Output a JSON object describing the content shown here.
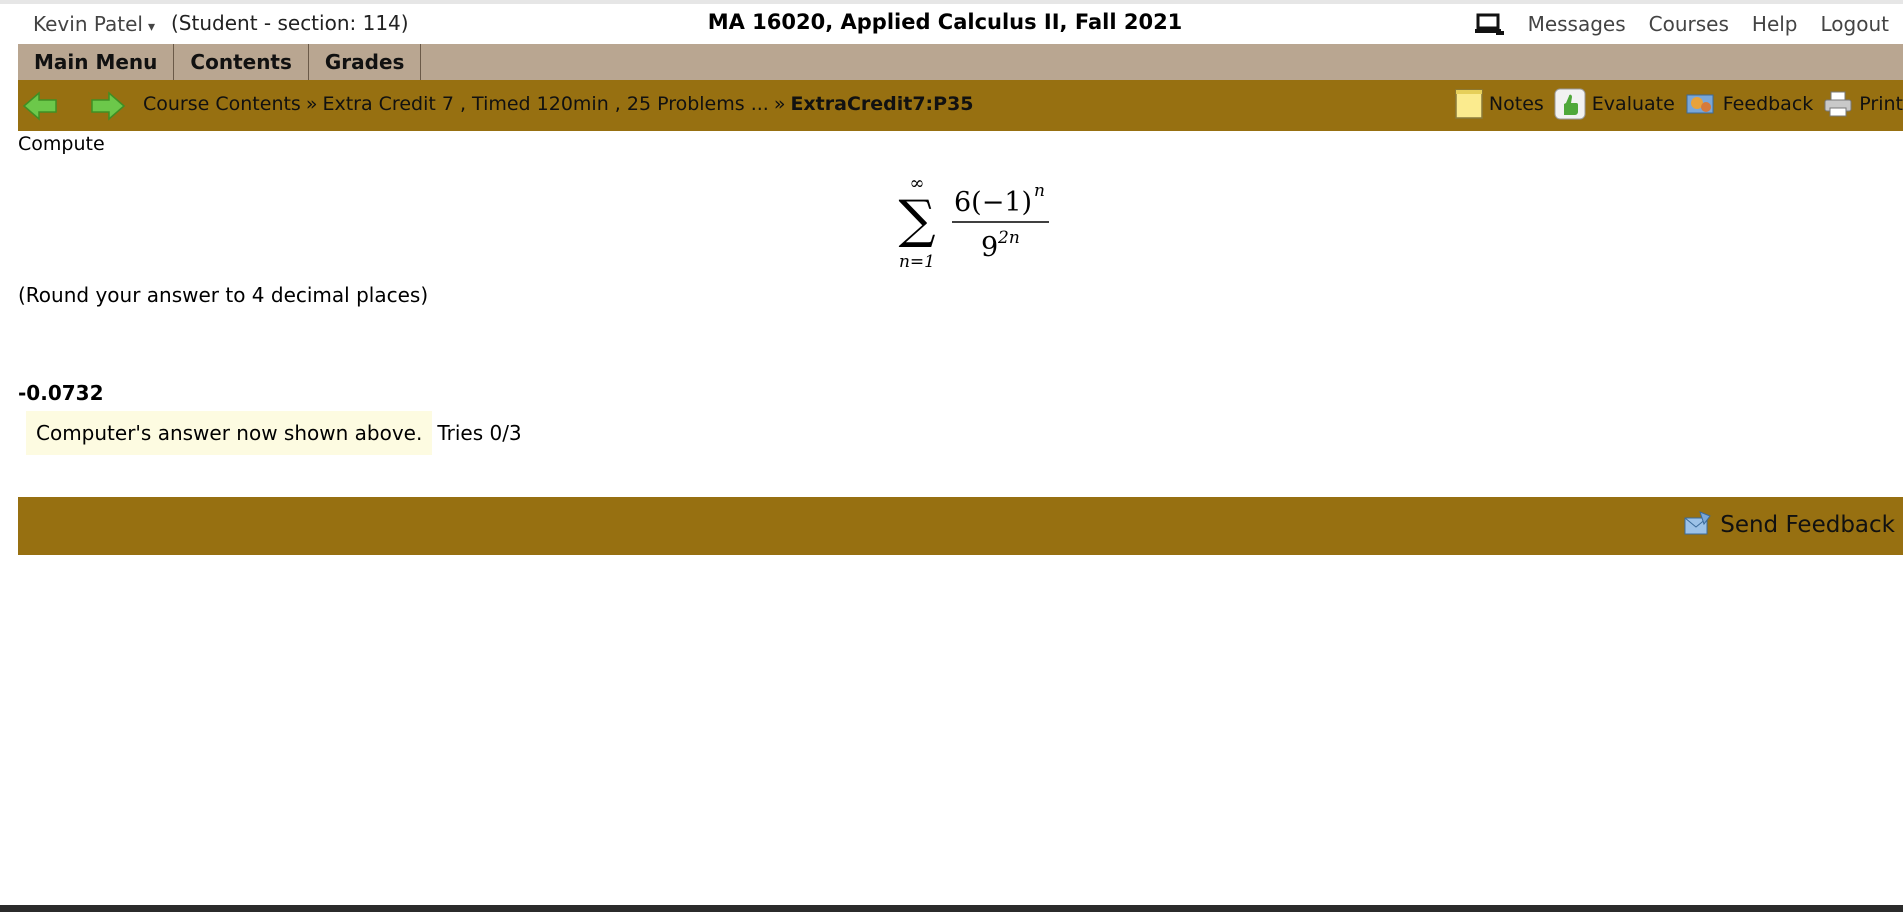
{
  "header": {
    "user_name": "Kevin Patel",
    "user_caret": "▾",
    "role": "(Student  - section: 114)",
    "course_title": "MA 16020, Applied Calculus II, Fall 2021",
    "links": {
      "messages": "Messages",
      "courses": "Courses",
      "help": "Help",
      "logout": "Logout"
    },
    "icon": "monitor-icon"
  },
  "menu": {
    "main_menu": "Main Menu",
    "contents": "Contents",
    "grades": "Grades"
  },
  "nav": {
    "back_icon": "back-arrow-icon",
    "forward_icon": "forward-arrow-icon",
    "breadcrumb": {
      "item1": "Course Contents",
      "separator": "»",
      "item2": "Extra Credit 7 , Timed 120min , 25 Problems ...",
      "current": "ExtraCredit7:P35"
    },
    "tools": {
      "notes": "Notes",
      "evaluate": "Evaluate",
      "feedback": "Feedback",
      "print": "Print"
    }
  },
  "problem": {
    "prompt": "Compute",
    "formula": {
      "sum_upper": "∞",
      "sum_symbol": "∑",
      "sum_lower": "n=1",
      "numerator_base": "6(−1)",
      "numerator_exp": "n",
      "denominator_base": "9",
      "denominator_exp": "2n"
    },
    "round_note": "(Round your answer to 4 decimal places)",
    "answer": "-0.0732",
    "status_message": "Computer's answer now shown above.",
    "tries": "Tries 0/3"
  },
  "footer": {
    "send_feedback": "Send Feedback"
  },
  "colors": {
    "menu_bar": "#b9a691",
    "nav_bar": "#977011",
    "message_bg": "#fdfbe1",
    "arrow_green": "#5cbf3a"
  }
}
